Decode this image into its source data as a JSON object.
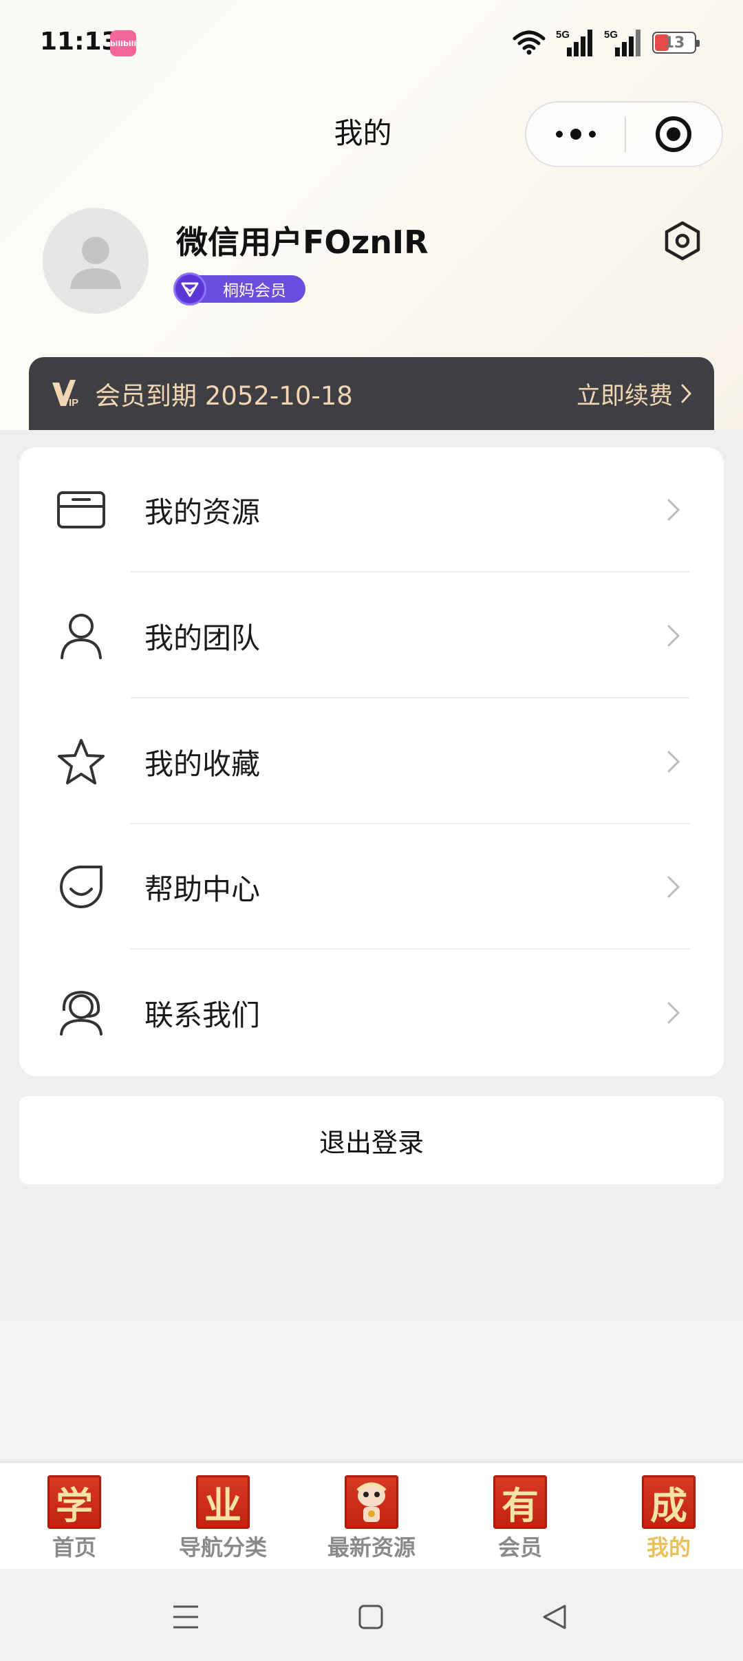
{
  "status_bar": {
    "time": "11:13",
    "app_badge": "bilibili",
    "network_1": "5G",
    "network_2": "5G",
    "battery": "13",
    "colors": {
      "battery_low": "#e84848",
      "app_badge": "#f2689a"
    }
  },
  "header": {
    "title": "我的",
    "more_icon": "more-dots-icon",
    "close_icon": "target-circle-icon"
  },
  "profile": {
    "username": "微信用户FOznIR",
    "member_tag": "桐妈会员",
    "avatar_icon": "default-avatar-icon",
    "settings_icon": "hexagon-settings-icon"
  },
  "vip_bar": {
    "logo": "VIP",
    "expiry_text": "会员到期 2052-10-18",
    "renew_label": "立即续费",
    "colors": {
      "background": "#3f3e43",
      "text": "#f0d6b2"
    }
  },
  "menu": {
    "items": [
      {
        "label": "我的资源",
        "icon": "card-icon"
      },
      {
        "label": "我的团队",
        "icon": "person-icon"
      },
      {
        "label": "我的收藏",
        "icon": "star-icon"
      },
      {
        "label": "帮助中心",
        "icon": "smile-icon"
      },
      {
        "label": "联系我们",
        "icon": "headset-icon"
      }
    ]
  },
  "logout_label": "退出登录",
  "tab_bar": {
    "items": [
      {
        "label": "首页",
        "glyph": "学",
        "active": false
      },
      {
        "label": "导航分类",
        "glyph": "业",
        "active": false
      },
      {
        "label": "最新资源",
        "glyph": "",
        "active": false
      },
      {
        "label": "会员",
        "glyph": "有",
        "active": false
      },
      {
        "label": "我的",
        "glyph": "成",
        "active": true
      }
    ],
    "colors": {
      "active": "#e9c05a",
      "inactive": "#8a8a8a",
      "icon_bg": "#d93a22"
    }
  },
  "system_nav": {
    "menu_icon": "menu-lines-icon",
    "home_icon": "square-home-icon",
    "back_icon": "triangle-back-icon"
  }
}
